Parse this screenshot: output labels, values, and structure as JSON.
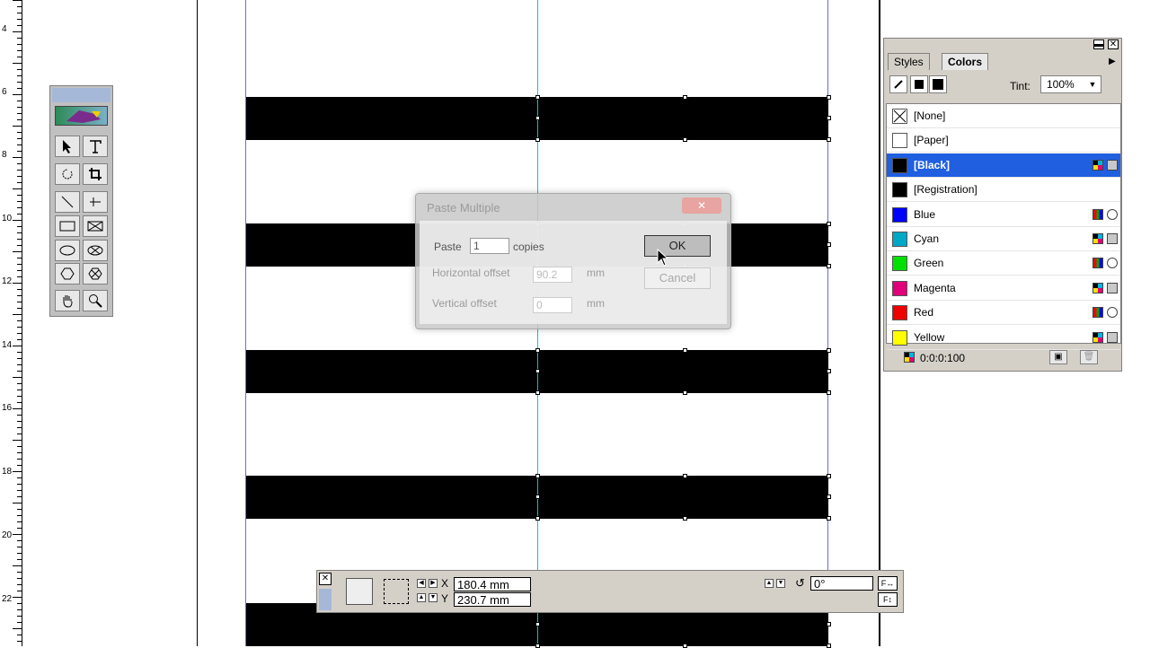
{
  "ruler": {
    "labels": [
      "4",
      "6",
      "8",
      "10",
      "12",
      "14",
      "16",
      "18",
      "20",
      "22"
    ]
  },
  "dialog": {
    "title": "Paste Multiple",
    "paste_label": "Paste",
    "paste_value": "1",
    "copies_label": "copies",
    "h_offset_label": "Horizontal offset",
    "h_offset_value": "90.2",
    "h_unit": "mm",
    "v_offset_label": "Vertical offset",
    "v_offset_value": "0",
    "v_unit": "mm",
    "ok_label": "OK",
    "cancel_label": "Cancel"
  },
  "palette": {
    "tabs": [
      "Styles",
      "Colors"
    ],
    "active_tab": "Colors",
    "tint_label": "Tint:",
    "tint_value": "100%",
    "colors": [
      {
        "name": "[None]",
        "swatch": "none",
        "mode": ""
      },
      {
        "name": "[Paper]",
        "swatch": "#ffffff",
        "mode": ""
      },
      {
        "name": "[Black]",
        "swatch": "#000000",
        "mode": "cmyk",
        "selected": true
      },
      {
        "name": "[Registration]",
        "swatch": "#000000",
        "mode": ""
      },
      {
        "name": "Blue",
        "swatch": "#0000ff",
        "mode": "rgb"
      },
      {
        "name": "Cyan",
        "swatch": "#00a8c8",
        "mode": "cmyk"
      },
      {
        "name": "Green",
        "swatch": "#00e000",
        "mode": "rgb"
      },
      {
        "name": "Magenta",
        "swatch": "#e0007a",
        "mode": "cmyk"
      },
      {
        "name": "Red",
        "swatch": "#ee0000",
        "mode": "rgb"
      },
      {
        "name": "Yellow",
        "swatch": "#ffff00",
        "mode": "cmyk"
      }
    ],
    "footer_value": "0:0:0:100"
  },
  "measurements": {
    "x_label": "X",
    "x_value": "180.4 mm",
    "y_label": "Y",
    "y_value": "230.7 mm",
    "angle_value": "0°"
  },
  "colors": {
    "selection": "#1f5fe0",
    "guide": "#00c8d8",
    "margin": "#6b6be0"
  }
}
